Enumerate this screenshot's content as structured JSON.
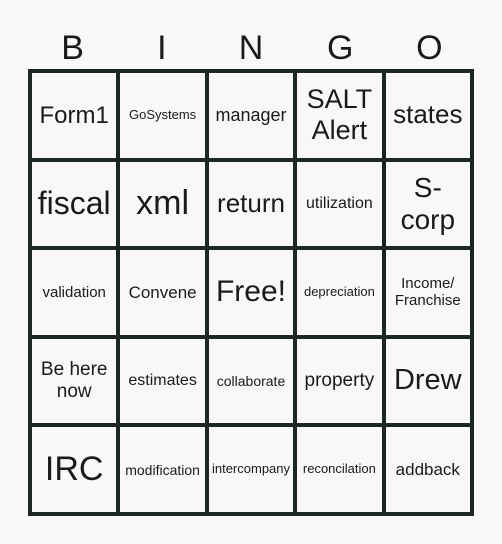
{
  "header": [
    "B",
    "I",
    "N",
    "G",
    "O"
  ],
  "cells": [
    {
      "text": "Form1",
      "size": 24
    },
    {
      "text": "GoSystems",
      "size": 13
    },
    {
      "text": "manager",
      "size": 18
    },
    {
      "text": "SALT Alert",
      "size": 27
    },
    {
      "text": "states",
      "size": 26
    },
    {
      "text": "fiscal",
      "size": 32
    },
    {
      "text": "xml",
      "size": 34
    },
    {
      "text": "return",
      "size": 26
    },
    {
      "text": "utilization",
      "size": 16
    },
    {
      "text": "S-corp",
      "size": 28
    },
    {
      "text": "validation",
      "size": 15
    },
    {
      "text": "Convene",
      "size": 17
    },
    {
      "text": "Free!",
      "size": 30
    },
    {
      "text": "depreciation",
      "size": 13
    },
    {
      "text": "Income/ Franchise",
      "size": 15
    },
    {
      "text": "Be here now",
      "size": 19
    },
    {
      "text": "estimates",
      "size": 16
    },
    {
      "text": "collaborate",
      "size": 14
    },
    {
      "text": "property",
      "size": 19
    },
    {
      "text": "Drew",
      "size": 29
    },
    {
      "text": "IRC",
      "size": 34
    },
    {
      "text": "modification",
      "size": 14
    },
    {
      "text": "intercompany",
      "size": 13
    },
    {
      "text": "reconcilation",
      "size": 13
    },
    {
      "text": "addback",
      "size": 17
    }
  ]
}
